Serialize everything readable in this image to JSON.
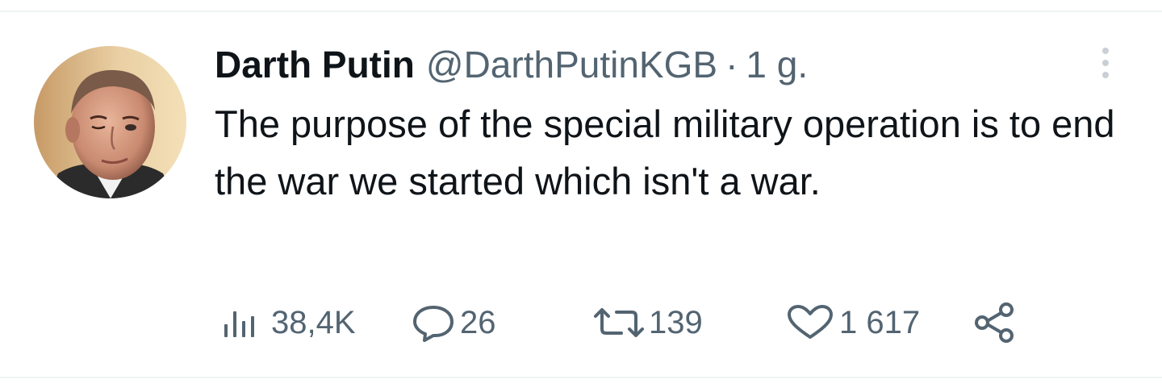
{
  "tweet": {
    "author_name": "Darth Putin",
    "handle": "@DarthPutinKGB",
    "separator": "·",
    "time": "1 g.",
    "text": "The purpose of the special military operation is to end the war we started which isn't a war."
  },
  "actions": {
    "views": "38,4K",
    "replies": "26",
    "retweets": "139",
    "likes": "1 617"
  },
  "icons": {
    "views": "views-bar-chart-icon",
    "reply": "speech-bubble-icon",
    "retweet": "retweet-arrows-icon",
    "like": "heart-icon",
    "share": "share-nodes-icon",
    "more": "more-vertical-dots-icon"
  },
  "colors": {
    "text": "#0f1419",
    "secondary": "#536471",
    "divider": "#eff3f4"
  }
}
